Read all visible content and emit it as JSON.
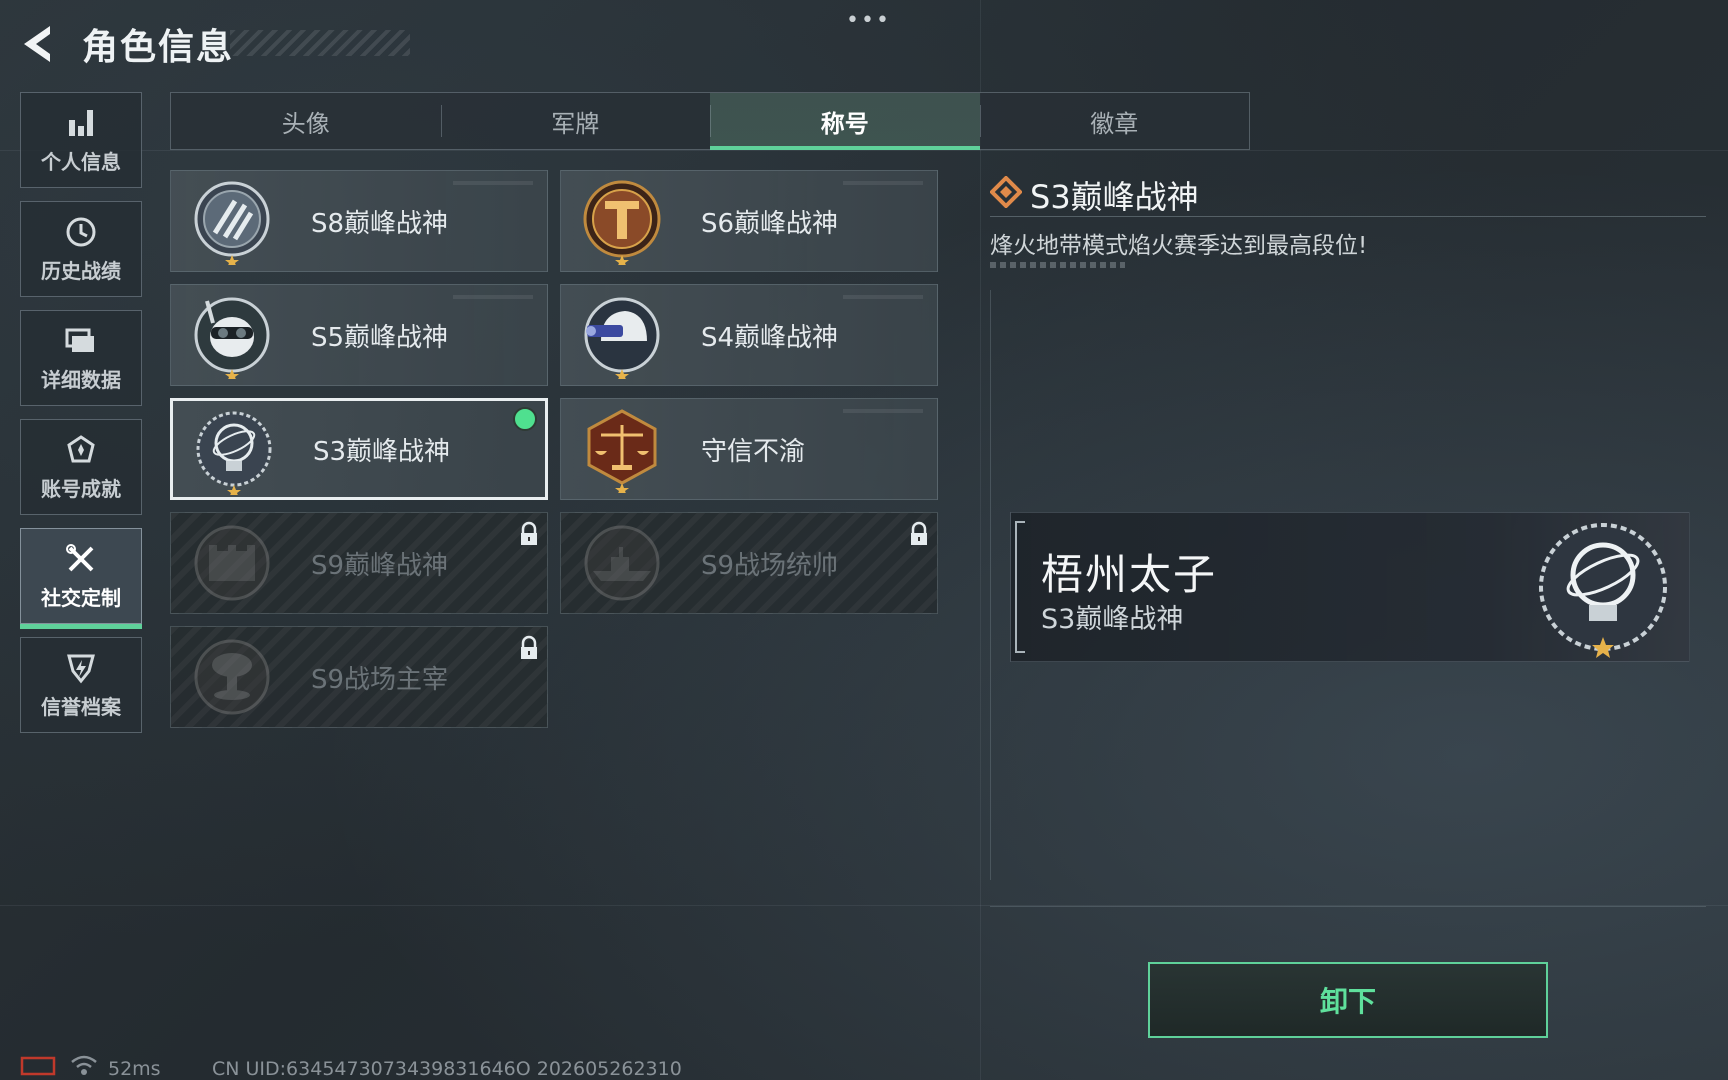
{
  "header": {
    "title": "角色信息",
    "more_dots": "•••"
  },
  "sidebar": {
    "items": [
      {
        "label": "个人信息",
        "icon": "bar-chart-icon"
      },
      {
        "label": "历史战绩",
        "icon": "clock-history-icon"
      },
      {
        "label": "详细数据",
        "icon": "folder-icon"
      },
      {
        "label": "账号成就",
        "icon": "achievement-badge-icon"
      },
      {
        "label": "社交定制",
        "icon": "tools-icon",
        "active": true
      },
      {
        "label": "信誉档案",
        "icon": "shield-lightning-icon"
      }
    ]
  },
  "tabs": [
    {
      "label": "头像"
    },
    {
      "label": "军牌"
    },
    {
      "label": "称号",
      "active": true
    },
    {
      "label": "徽章"
    }
  ],
  "titles": [
    {
      "label": "S8巅峰战神",
      "badge": "stripes-emblem-icon",
      "locked": false
    },
    {
      "label": "S6巅峰战神",
      "badge": "tactical-t-emblem-icon",
      "locked": false
    },
    {
      "label": "S5巅峰战神",
      "badge": "skull-diver-emblem-icon",
      "locked": false
    },
    {
      "label": "S4巅峰战神",
      "badge": "helmet-nightvision-emblem-icon",
      "locked": false
    },
    {
      "label": "S3巅峰战神",
      "badge": "armillary-sphere-emblem-icon",
      "locked": false,
      "selected": true
    },
    {
      "label": "守信不渝",
      "badge": "scales-emblem-icon",
      "locked": false
    },
    {
      "label": "S9巅峰战神",
      "badge": "fortress-emblem-icon",
      "locked": true
    },
    {
      "label": "S9战场统帅",
      "badge": "warship-emblem-icon",
      "locked": true
    },
    {
      "label": "S9战场主宰",
      "badge": "mushroom-cloud-emblem-icon",
      "locked": true
    }
  ],
  "detail": {
    "title": "S3巅峰战神",
    "description": "烽火地带模式焰火赛季达到最高段位!"
  },
  "preview": {
    "player_name": "梧州太子",
    "equipped_title": "S3巅峰战神"
  },
  "actions": {
    "unequip_label": "卸下"
  },
  "footer": {
    "ping": "52ms",
    "uid": "CN UID:6345473073439831646O 202605262310"
  },
  "colors": {
    "accent_green": "#5fd19a",
    "selected_dot": "#4fe08f",
    "bronze": "#8a4a28",
    "silver": "#b8c2c8"
  }
}
